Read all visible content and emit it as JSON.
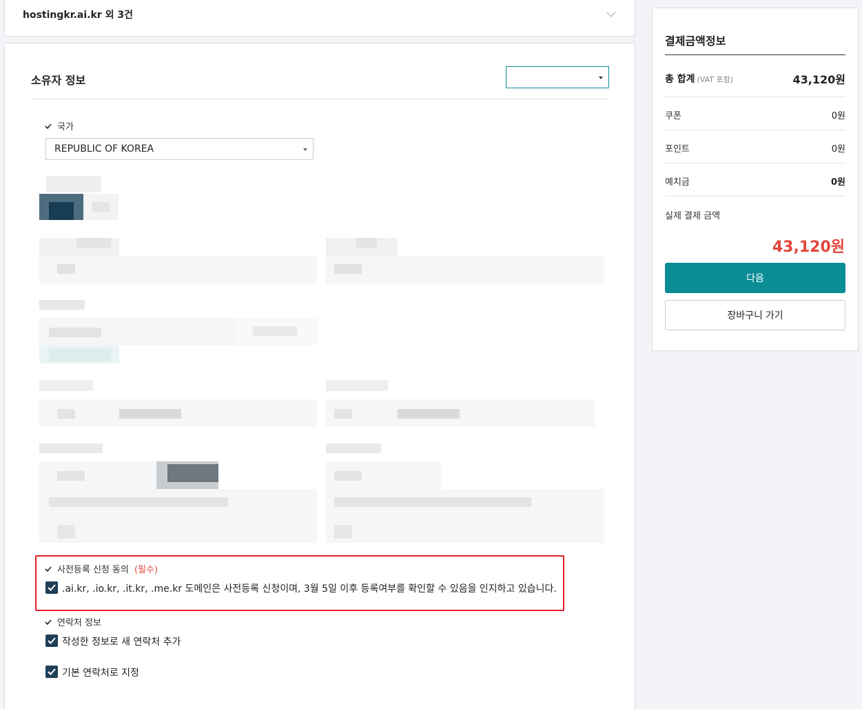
{
  "order_bar": {
    "domain_summary": "hostingkr.ai.kr 외 3건"
  },
  "owner": {
    "section_title": "소유자 정보",
    "country_label": "국가",
    "country_value": "REPUBLIC OF KOREA",
    "consent_label": "사전등록 신청 동의",
    "consent_required": "(필수)",
    "consent_text": ".ai.kr, .io.kr, .it.kr, .me.kr 도메인은 사전등록 신청이며, 3월 5일 이후 등록여부를 확인할 수 있음을 인지하고 있습니다.",
    "contact_label": "연락처 정보",
    "add_contact_text": "작성한 정보로 새 연락처 추가",
    "default_contact_text": "기본 연락처로 지정"
  },
  "summary": {
    "title": "결제금액정보",
    "total_label": "총 합계",
    "vat_note": "(VAT 포함)",
    "total_value": "43,120원",
    "coupon_label": "쿠폰",
    "coupon_value": "0원",
    "point_label": "포인트",
    "point_value": "0원",
    "deposit_label": "예치금",
    "deposit_value": "0원",
    "actual_label": "실제 결제 금액",
    "actual_value": "43,120원",
    "next_button": "다음",
    "cart_button": "장바구니 가기"
  },
  "colors": {
    "accent": "#0b8d96",
    "price_red": "#e2463b",
    "highlight_border": "#e3202b",
    "checkbox": "#1f3f57"
  }
}
